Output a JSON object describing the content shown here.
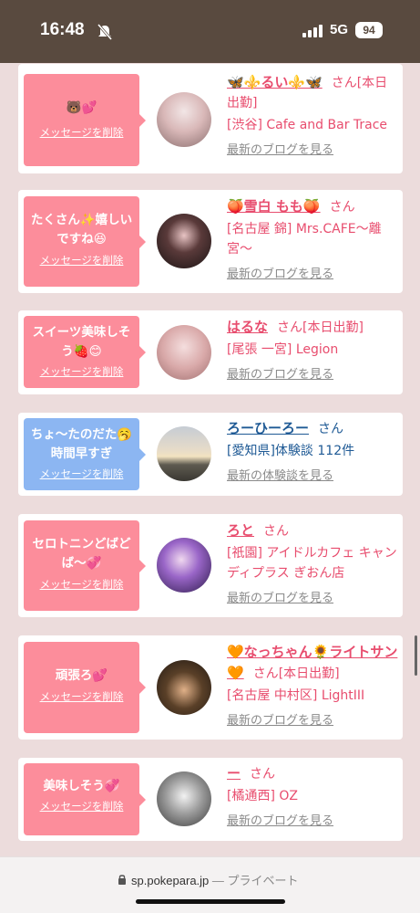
{
  "status_bar": {
    "time": "16:48",
    "network": "5G",
    "battery": "94"
  },
  "delete_label": "メッセージを削除",
  "entries": [
    {
      "message": "🐻💕",
      "cast_name": "🦋⚜️るい⚜️🦋",
      "honorific": "さん",
      "status": "[本日出勤]",
      "area": "[渋谷] Cafe and Bar Trace",
      "link": "最新のブログを見る"
    },
    {
      "message": "たくさん✨嬉しいですね😆",
      "cast_name": "🍑雪白 もも🍑",
      "honorific": "さん",
      "status": "",
      "area": "[名古屋 錦] Mrs.CAFE〜離宮〜",
      "link": "最新のブログを見る"
    },
    {
      "message": "スイーツ美味しそう🍓😊",
      "cast_name": "はるな",
      "honorific": "さん",
      "status": "[本日出勤]",
      "area": "[尾張 一宮] Legion",
      "link": "最新のブログを見る"
    },
    {
      "message": "ちょ〜たのだた🥱時間早すぎ",
      "cast_name": "ろーひーろー",
      "honorific": "さん",
      "status": "",
      "area": "[愛知県]体験談 112件",
      "link": "最新の体験談を見る"
    },
    {
      "message": "セロトニンどばどば〜💞",
      "cast_name": "ろと",
      "honorific": "さん",
      "status": "",
      "area": "[祇園] アイドルカフェ キャンディプラス ぎおん店",
      "link": "最新のブログを見る"
    },
    {
      "message": "頑張ろ💕",
      "cast_name": "🧡なっちゃん🌻ライトサン🧡",
      "honorific": "さん",
      "status": "[本日出勤]",
      "area": "[名古屋 中村区] LightIII",
      "link": "最新のブログを見る"
    },
    {
      "message": "美味しそう💞",
      "cast_name": "ー",
      "honorific": "さん",
      "status": "",
      "area": "[橘通西] OZ",
      "link": "最新のブログを見る"
    }
  ],
  "url_bar": {
    "domain": "sp.pokepara.jp",
    "separator": " — ",
    "mode": "プライベート"
  }
}
